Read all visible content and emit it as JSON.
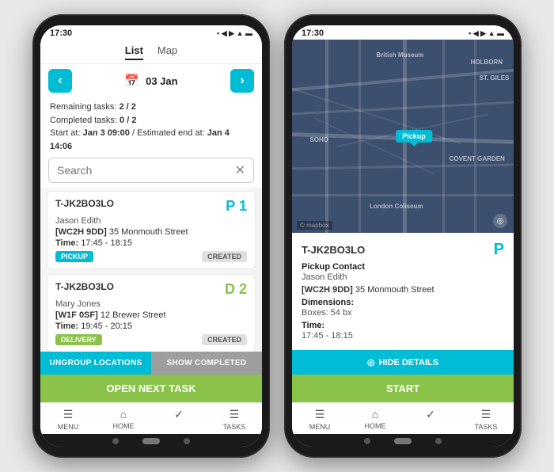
{
  "phone1": {
    "statusBar": {
      "time": "17:30",
      "icons": "▪ ◀ ▶ ▲ ☰"
    },
    "tabs": [
      {
        "label": "List",
        "active": true
      },
      {
        "label": "Map",
        "active": false
      }
    ],
    "dateNav": {
      "prevLabel": "‹",
      "nextLabel": "›",
      "calendarIcon": "📅",
      "date": "03 Jan"
    },
    "taskInfo": {
      "remaining": "Remaining tasks: 2 / 2",
      "completed": "Completed tasks: 0 / 2",
      "timeRange": "Start at: Jan 3 09:00 / Estimated end at: Jan 4 14:06"
    },
    "search": {
      "placeholder": "Search",
      "clearIcon": "✕"
    },
    "tasks": [
      {
        "id": "T-JK2BO3LO",
        "name": "Jason Edith",
        "postcode": "WC2H 9DD",
        "address": "35 Monmouth Street",
        "timeLabel": "Time:",
        "time": "17:45 - 18:15",
        "type": "PICKUP",
        "status": "CREATED",
        "priorityLabel": "P",
        "priorityNum": "1",
        "priorityClass": "priority-p",
        "badgeClass": "badge-pickup"
      },
      {
        "id": "T-JK2BO3LO",
        "name": "Mary Jones",
        "postcode": "W1F 0SF",
        "address": "12 Brewer Street",
        "timeLabel": "Time:",
        "time": "19:45 - 20:15",
        "type": "DELIVERY",
        "status": "CREATED",
        "priorityLabel": "D",
        "priorityNum": "2",
        "priorityClass": "priority-d",
        "badgeClass": "badge-delivery"
      }
    ],
    "bottomActions": {
      "ungroupLabel": "UNGROUP LOCATIONS",
      "showCompletedLabel": "SHOW COMPLETED",
      "openNextLabel": "OPEN NEXT TASK"
    },
    "bottomNav": [
      {
        "icon": "☰",
        "label": "MENU"
      },
      {
        "icon": "⌂",
        "label": "HOME"
      },
      {
        "icon": "✓",
        "label": ""
      },
      {
        "icon": "☰",
        "label": "TASKS"
      }
    ]
  },
  "phone2": {
    "statusBar": {
      "time": "17:30",
      "icons": "▪ ◀ ▶ ▲ ☰"
    },
    "map": {
      "pickupLabel": "Pickup",
      "labels": [
        "British Museum",
        "HOLBORN",
        "ST. GILES",
        "SOHO",
        "COVENT GARDEN",
        "London Coliseum"
      ],
      "credit": "© mapbox",
      "compassIcon": "◎"
    },
    "detail": {
      "id": "T-JK2BO3LO",
      "priorityLabel": "P",
      "sectionPickup": "Pickup Contact",
      "contactName": "Jason Edith",
      "postcode": "WC2H 9DD",
      "address": "35 Monmouth Street",
      "dimensionsLabel": "Dimensions:",
      "dimensions": "Boxes: 54 bx",
      "timeLabel": "Time:",
      "time": "17:45 - 18:15"
    },
    "actions": {
      "hideDetailsIcon": "◎",
      "hideDetailsLabel": "HIDE DETAILS",
      "startLabel": "START"
    },
    "bottomNav": [
      {
        "icon": "☰",
        "label": "MENU"
      },
      {
        "icon": "⌂",
        "label": "HOME"
      },
      {
        "icon": "✓",
        "label": ""
      },
      {
        "icon": "☰",
        "label": "TASKS"
      }
    ]
  }
}
